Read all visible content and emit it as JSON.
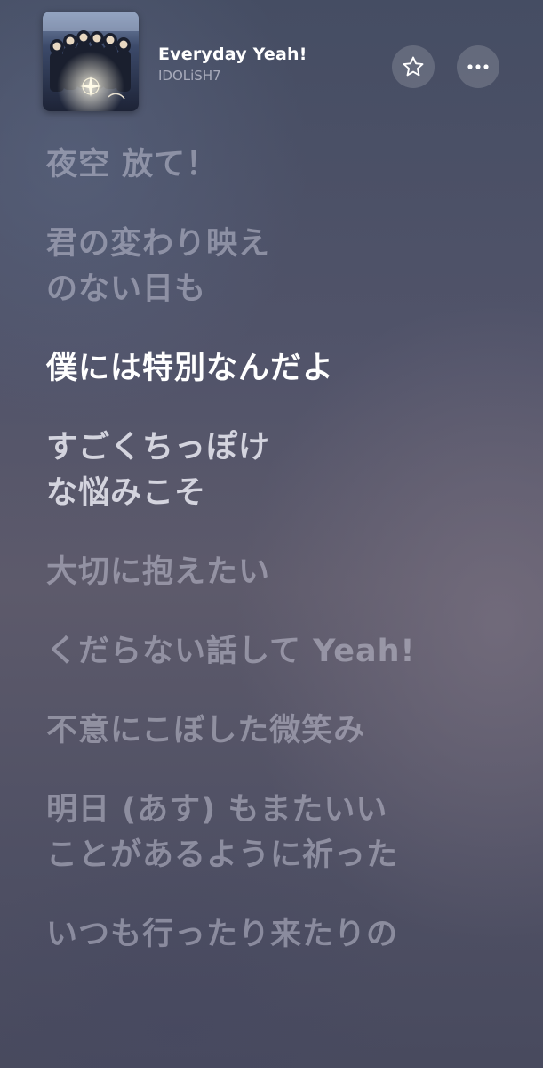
{
  "now_playing": {
    "title": "Everyday Yeah!",
    "artist": "IDOLiSH7"
  },
  "buttons": {
    "favorite_icon": "star-icon",
    "more_icon": "ellipsis-icon"
  },
  "lyrics": [
    {
      "text": "夜空 放て！",
      "state": "past"
    },
    {
      "text": "君の変わり映え\nのない日も",
      "state": "past"
    },
    {
      "text": "僕には特別なんだよ",
      "state": "active"
    },
    {
      "text": "すごくちっぽけ\nな悩みこそ",
      "state": "upcoming-near"
    },
    {
      "text": "大切に抱えたい",
      "state": "upcoming"
    },
    {
      "text": "くだらない話して Yeah!",
      "state": "upcoming"
    },
    {
      "text": "不意にこぼした微笑み",
      "state": "upcoming"
    },
    {
      "text": "明日 (あす) もまたいい\nことがあるように祈った",
      "state": "upcoming"
    },
    {
      "text": "いつも行ったり来たりの",
      "state": "upcoming"
    }
  ],
  "colors": {
    "active_lyric": "#ffffff",
    "inactive_lyric": "#d6d6e4",
    "background_top": "#454d63",
    "background_bottom": "#484a5e"
  }
}
